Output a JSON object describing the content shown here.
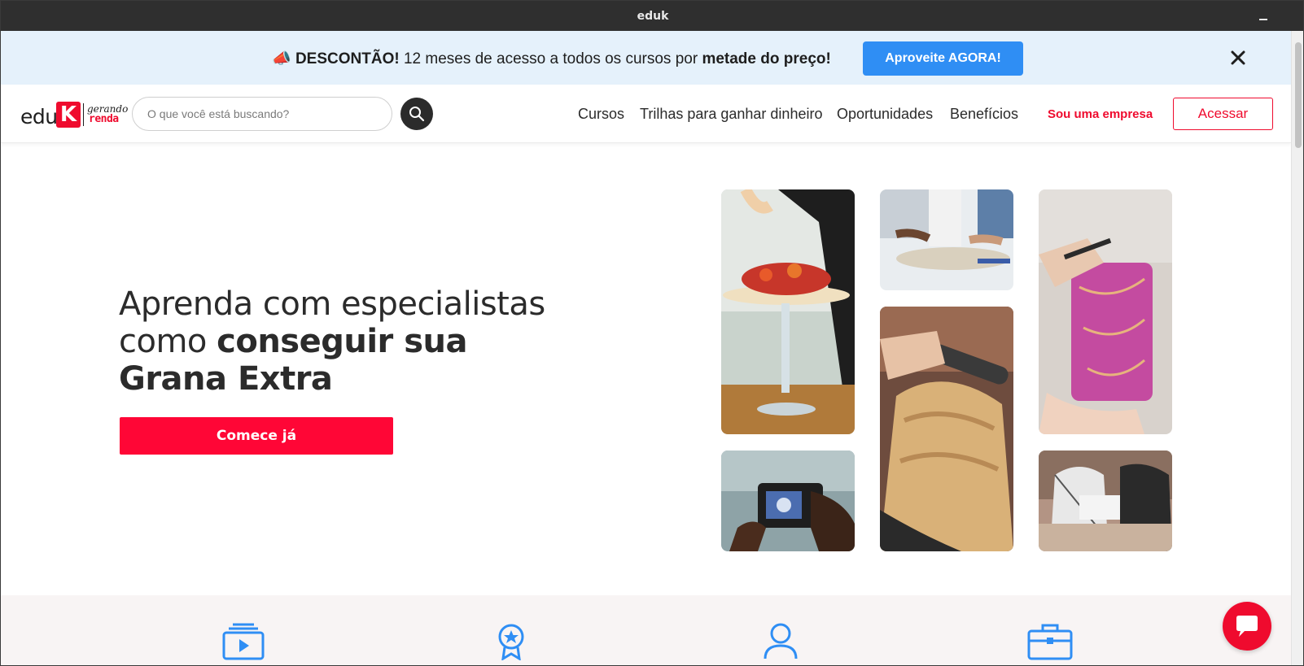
{
  "window": {
    "title": "eduk"
  },
  "promo": {
    "emoji": "📣",
    "bold_lead": "DESCONTÃO!",
    "text": " 12 meses de acesso a todos os cursos por ",
    "bold_tail": "metade do preço!",
    "button_label": "Aproveite AGORA!"
  },
  "header": {
    "logo": {
      "edu": "edu",
      "k": "K",
      "gerando": "gerando",
      "renda": "renda"
    },
    "search_placeholder": "O que você está buscando?",
    "nav": [
      "Cursos",
      "Trilhas para ganhar dinheiro",
      "Oportunidades",
      "Benefícios"
    ],
    "empresa_label": "Sou uma empresa",
    "login_label": "Acessar"
  },
  "hero": {
    "line1": "Aprenda com especialistas",
    "line2_plain": "como ",
    "line2_bold": "conseguir sua",
    "line3_bold": "Grana Extra",
    "cta_label": "Comece já"
  },
  "photos": [
    "cake-decorating-photo",
    "sewing-machine-photo",
    "glass-painting-photo",
    "hair-styling-photo",
    "camera-photography-photo",
    "cooking-class-photo"
  ],
  "features_icons": [
    "video-lessons-icon",
    "certificate-icon",
    "user-profile-icon",
    "briefcase-icon"
  ],
  "colors": {
    "brand_red": "#ef0b2e",
    "cta_red": "#ff0636",
    "promo_blue": "#2f8ef4",
    "promo_bg": "#e5f1fb",
    "icon_blue": "#2f8ef4"
  }
}
